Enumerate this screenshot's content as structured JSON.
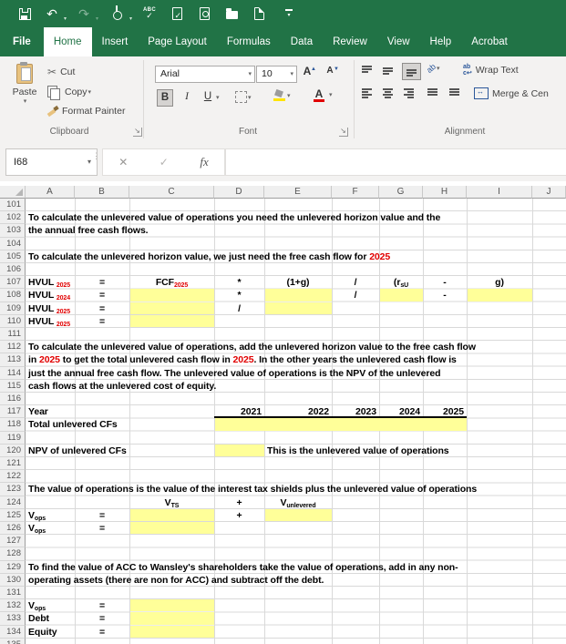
{
  "colors": {
    "titlebar_green": "#217346",
    "ribbon_bg": "#f3f2f1",
    "yellow_fill": "#ffff99",
    "red_text": "#e10000",
    "fill_accent_yellow": "#ffe400",
    "font_accent_red": "#e10000"
  },
  "qat": {
    "icons": [
      "save-icon",
      "undo-icon",
      "redo-icon",
      "touch-mode-icon",
      "spelling-icon",
      "quick-print-icon",
      "print-preview-icon",
      "open-icon",
      "new-file-icon",
      "customize-quick-access-icon"
    ]
  },
  "tabs": [
    {
      "label": "File"
    },
    {
      "label": "Home"
    },
    {
      "label": "Insert"
    },
    {
      "label": "Page Layout"
    },
    {
      "label": "Formulas"
    },
    {
      "label": "Data"
    },
    {
      "label": "Review"
    },
    {
      "label": "View"
    },
    {
      "label": "Help"
    },
    {
      "label": "Acrobat"
    }
  ],
  "ribbon": {
    "clipboard": {
      "label": "Clipboard",
      "paste": "Paste",
      "cut": "Cut",
      "copy": "Copy",
      "format_painter": "Format Painter"
    },
    "font": {
      "label": "Font",
      "family": "Arial",
      "size": "10",
      "bold": "B",
      "italic": "I",
      "underline": "U"
    },
    "alignment": {
      "label": "Alignment",
      "wrap": "Wrap Text",
      "merge": "Merge & Cen"
    }
  },
  "formula_bar": {
    "name_box": "I68",
    "fx_label": "fx",
    "value": ""
  },
  "grid": {
    "columns": [
      "A",
      "B",
      "C",
      "D",
      "E",
      "F",
      "G",
      "H",
      "I",
      "J"
    ],
    "row_start": 101,
    "row_end": 135,
    "rows": {
      "102": [
        {
          "c": "A",
          "s": [
            {
              "t": "To calculate the unlevered value of operations you need the unlevered horizon value and the"
            }
          ]
        }
      ],
      "103": [
        {
          "c": "A",
          "s": [
            {
              "t": "the annual free cash flows."
            }
          ]
        }
      ],
      "105": [
        {
          "c": "A",
          "s": [
            {
              "t": "To calculate the unlevered horizon value, we just need the free cash flow for "
            },
            {
              "t": "2025",
              "red": true
            }
          ]
        }
      ],
      "107": [
        {
          "c": "A",
          "s": [
            {
              "t": "HVUL "
            },
            {
              "t": "2025",
              "sub": true,
              "red": true
            }
          ]
        },
        {
          "c": "B",
          "a": "c",
          "s": [
            {
              "t": "="
            }
          ]
        },
        {
          "c": "C",
          "a": "c",
          "s": [
            {
              "t": "FCF"
            },
            {
              "t": "2025",
              "sub": true,
              "red": true
            }
          ]
        },
        {
          "c": "D",
          "a": "c",
          "s": [
            {
              "t": "*"
            }
          ]
        },
        {
          "c": "E",
          "a": "c",
          "s": [
            {
              "t": "(1+g)"
            }
          ]
        },
        {
          "c": "F",
          "a": "c",
          "s": [
            {
              "t": "/"
            }
          ]
        },
        {
          "c": "G",
          "a": "c",
          "s": [
            {
              "t": "(r"
            },
            {
              "t": "sU",
              "sub": true
            }
          ]
        },
        {
          "c": "H",
          "a": "c",
          "s": [
            {
              "t": "-"
            }
          ]
        },
        {
          "c": "I",
          "a": "c",
          "s": [
            {
              "t": "g)"
            }
          ]
        }
      ],
      "108": [
        {
          "c": "A",
          "s": [
            {
              "t": "HVUL "
            },
            {
              "t": "2024",
              "sub": true,
              "red": true
            }
          ]
        },
        {
          "c": "B",
          "a": "c",
          "s": [
            {
              "t": "="
            }
          ]
        },
        {
          "c": "C",
          "f": true
        },
        {
          "c": "D",
          "a": "c",
          "s": [
            {
              "t": "*"
            }
          ]
        },
        {
          "c": "E",
          "f": true
        },
        {
          "c": "F",
          "a": "c",
          "s": [
            {
              "t": "/"
            }
          ]
        },
        {
          "c": "G",
          "f": true
        },
        {
          "c": "H",
          "a": "c",
          "s": [
            {
              "t": "-"
            }
          ]
        },
        {
          "c": "I",
          "f": true
        }
      ],
      "109": [
        {
          "c": "A",
          "s": [
            {
              "t": "HVUL "
            },
            {
              "t": "2025",
              "sub": true,
              "red": true
            }
          ]
        },
        {
          "c": "B",
          "a": "c",
          "s": [
            {
              "t": "="
            }
          ]
        },
        {
          "c": "C",
          "f": true
        },
        {
          "c": "D",
          "a": "c",
          "s": [
            {
              "t": "/"
            }
          ]
        },
        {
          "c": "E",
          "f": true
        }
      ],
      "110": [
        {
          "c": "A",
          "s": [
            {
              "t": "HVUL "
            },
            {
              "t": "2025",
              "sub": true,
              "red": true
            }
          ]
        },
        {
          "c": "B",
          "a": "c",
          "s": [
            {
              "t": "="
            }
          ]
        },
        {
          "c": "C",
          "f": true
        }
      ],
      "112": [
        {
          "c": "A",
          "s": [
            {
              "t": "To calculate the unlevered value of operations, add the unlevered horizon value to the free cash flow"
            }
          ]
        }
      ],
      "113": [
        {
          "c": "A",
          "s": [
            {
              "t": "in "
            },
            {
              "t": "2025",
              "red": true
            },
            {
              "t": " to get the total unlevered cash flow in "
            },
            {
              "t": "2025",
              "red": true
            },
            {
              "t": ".  In the other years the unlevered cash flow is"
            }
          ]
        }
      ],
      "114": [
        {
          "c": "A",
          "s": [
            {
              "t": "just the annual free cash flow.  The unlevered value of operations is the NPV of the unlevered"
            }
          ]
        }
      ],
      "115": [
        {
          "c": "A",
          "s": [
            {
              "t": "cash flows at the unlevered cost of equity."
            }
          ]
        }
      ],
      "117": [
        {
          "c": "A",
          "s": [
            {
              "t": "Year"
            }
          ]
        },
        {
          "c": "D",
          "a": "r",
          "bb": true,
          "s": [
            {
              "t": "2021"
            }
          ]
        },
        {
          "c": "E",
          "a": "r",
          "bb": true,
          "s": [
            {
              "t": "2022"
            }
          ]
        },
        {
          "c": "F",
          "a": "r",
          "bb": true,
          "s": [
            {
              "t": "2023"
            }
          ]
        },
        {
          "c": "G",
          "a": "r",
          "bb": true,
          "s": [
            {
              "t": "2024"
            }
          ]
        },
        {
          "c": "H",
          "a": "r",
          "bb": true,
          "s": [
            {
              "t": "2025"
            }
          ]
        }
      ],
      "118": [
        {
          "c": "A",
          "s": [
            {
              "t": "Total unlevered CFs"
            }
          ]
        },
        {
          "c": "D",
          "f": true,
          "span": 5
        }
      ],
      "120": [
        {
          "c": "A",
          "s": [
            {
              "t": "NPV of unlevered CFs"
            }
          ]
        },
        {
          "c": "D",
          "f": true
        },
        {
          "c": "E",
          "s": [
            {
              "t": "This is the unlevered value of operations"
            }
          ]
        }
      ],
      "123": [
        {
          "c": "A",
          "s": [
            {
              "t": "The value of operations is the value of the interest tax shields plus the unlevered value of operations"
            }
          ]
        }
      ],
      "124": [
        {
          "c": "C",
          "a": "c",
          "s": [
            {
              "t": "V"
            },
            {
              "t": "TS",
              "sub": true
            }
          ]
        },
        {
          "c": "D",
          "a": "c",
          "s": [
            {
              "t": "+"
            }
          ]
        },
        {
          "c": "E",
          "a": "c",
          "s": [
            {
              "t": "V"
            },
            {
              "t": "unlevered",
              "sub": true
            }
          ]
        }
      ],
      "125": [
        {
          "c": "A",
          "s": [
            {
              "t": "V"
            },
            {
              "t": "ops",
              "sub": true
            }
          ]
        },
        {
          "c": "B",
          "a": "c",
          "s": [
            {
              "t": "="
            }
          ]
        },
        {
          "c": "C",
          "f": true
        },
        {
          "c": "D",
          "a": "c",
          "s": [
            {
              "t": "+"
            }
          ]
        },
        {
          "c": "E",
          "f": true
        }
      ],
      "126": [
        {
          "c": "A",
          "s": [
            {
              "t": "V"
            },
            {
              "t": "ops",
              "sub": true
            }
          ]
        },
        {
          "c": "B",
          "a": "c",
          "s": [
            {
              "t": "="
            }
          ]
        },
        {
          "c": "C",
          "f": true
        }
      ],
      "129": [
        {
          "c": "A",
          "s": [
            {
              "t": "To find the value of ACC to Wansley's shareholders take the value of operations, add in any non-"
            }
          ]
        }
      ],
      "130": [
        {
          "c": "A",
          "s": [
            {
              "t": "operating assets (there are non for ACC) and subtract off the debt."
            }
          ]
        }
      ],
      "132": [
        {
          "c": "A",
          "s": [
            {
              "t": "V"
            },
            {
              "t": "ops",
              "sub": true
            }
          ]
        },
        {
          "c": "B",
          "a": "c",
          "s": [
            {
              "t": "="
            }
          ]
        },
        {
          "c": "C",
          "f": true
        }
      ],
      "133": [
        {
          "c": "A",
          "s": [
            {
              "t": "Debt"
            }
          ]
        },
        {
          "c": "B",
          "a": "c",
          "s": [
            {
              "t": "="
            }
          ]
        },
        {
          "c": "C",
          "f": true
        }
      ],
      "134": [
        {
          "c": "A",
          "s": [
            {
              "t": "Equity"
            }
          ]
        },
        {
          "c": "B",
          "a": "c",
          "s": [
            {
              "t": "="
            }
          ]
        },
        {
          "c": "C",
          "f": true
        }
      ]
    }
  }
}
